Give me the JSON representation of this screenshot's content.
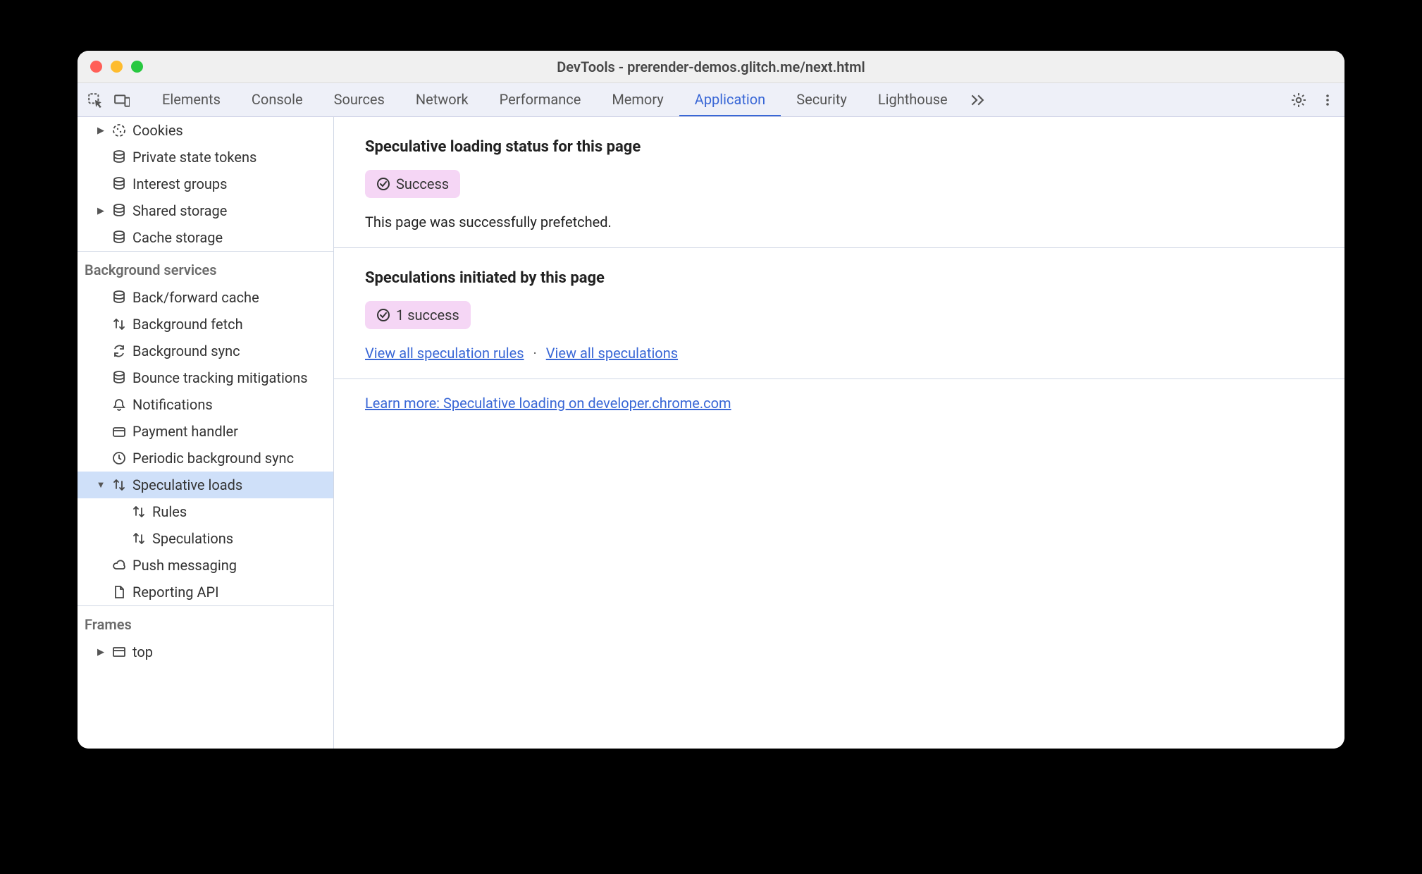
{
  "window": {
    "title": "DevTools - prerender-demos.glitch.me/next.html"
  },
  "tabs": {
    "items": [
      "Elements",
      "Console",
      "Sources",
      "Network",
      "Performance",
      "Memory",
      "Application",
      "Security",
      "Lighthouse"
    ],
    "active": "Application"
  },
  "sidebar": {
    "storage": [
      {
        "label": "Cookies",
        "icon": "cookie",
        "expander": "▶"
      },
      {
        "label": "Private state tokens",
        "icon": "db"
      },
      {
        "label": "Interest groups",
        "icon": "db"
      },
      {
        "label": "Shared storage",
        "icon": "db",
        "expander": "▶"
      },
      {
        "label": "Cache storage",
        "icon": "db"
      }
    ],
    "bg_title": "Background services",
    "bg": [
      {
        "label": "Back/forward cache",
        "icon": "db"
      },
      {
        "label": "Background fetch",
        "icon": "updown"
      },
      {
        "label": "Background sync",
        "icon": "sync"
      },
      {
        "label": "Bounce tracking mitigations",
        "icon": "db"
      },
      {
        "label": "Notifications",
        "icon": "bell"
      },
      {
        "label": "Payment handler",
        "icon": "card"
      },
      {
        "label": "Periodic background sync",
        "icon": "clock"
      },
      {
        "label": "Speculative loads",
        "icon": "updown",
        "expander": "▼",
        "selected": true
      },
      {
        "label": "Rules",
        "icon": "updown",
        "indent": 2
      },
      {
        "label": "Speculations",
        "icon": "updown",
        "indent": 2
      },
      {
        "label": "Push messaging",
        "icon": "cloud"
      },
      {
        "label": "Reporting API",
        "icon": "doc"
      }
    ],
    "frames_title": "Frames",
    "frames": [
      {
        "label": "top",
        "icon": "frame",
        "expander": "▶"
      }
    ]
  },
  "main": {
    "s1_title": "Speculative loading status for this page",
    "s1_badge": "Success",
    "s1_body": "This page was successfully prefetched.",
    "s2_title": "Speculations initiated by this page",
    "s2_badge": "1 success",
    "link_rules": "View all speculation rules",
    "link_specs": "View all speculations",
    "learn_more": "Learn more: Speculative loading on developer.chrome.com"
  }
}
